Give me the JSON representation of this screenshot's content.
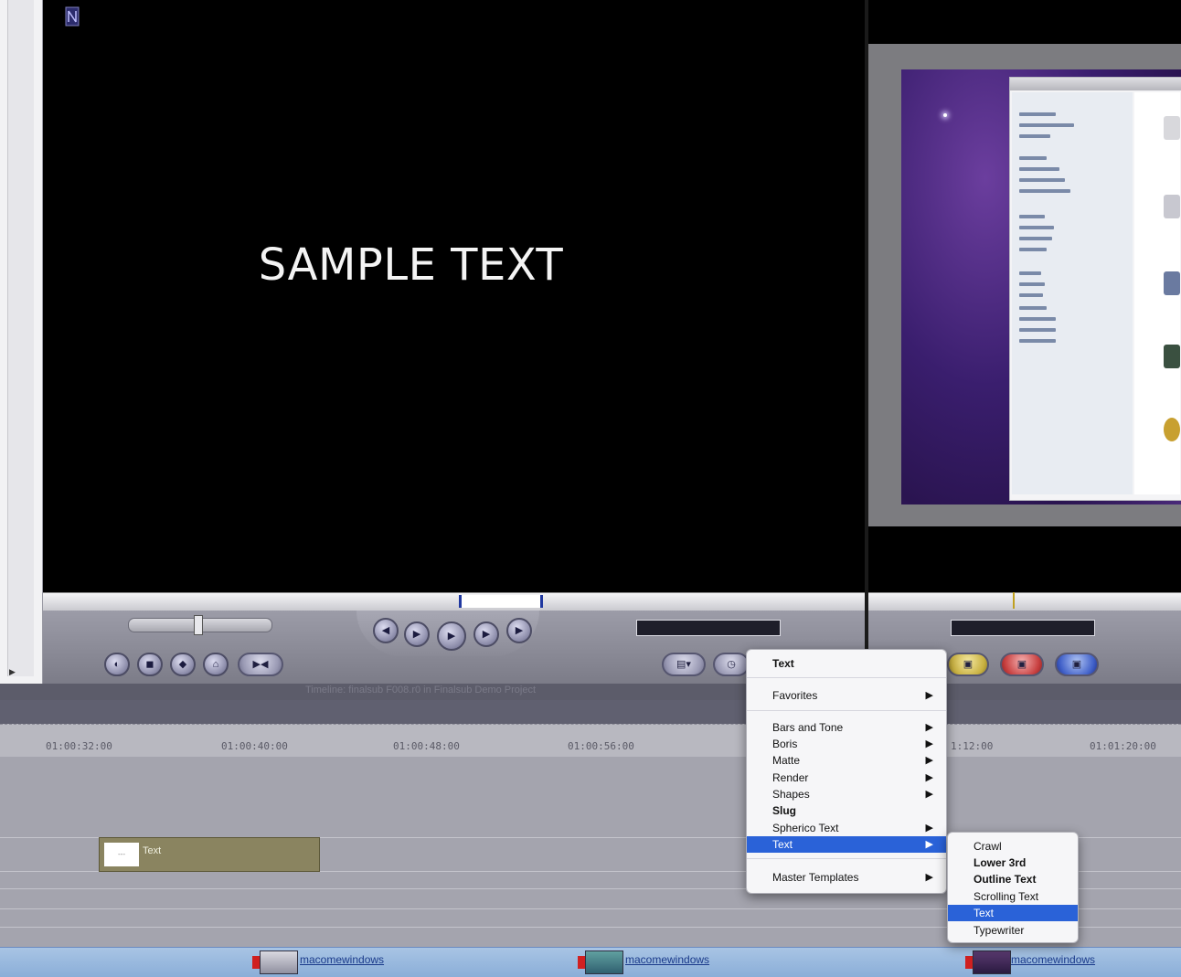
{
  "viewer": {
    "overlay_text": "SAMPLE TEXT"
  },
  "timeline": {
    "title": "Timeline: finalsub F008.r0 in Finalsub Demo Project",
    "timecodes": [
      "01:00:32:00",
      "01:00:40:00",
      "01:00:48:00",
      "01:00:56:00",
      "1:12:00",
      "01:01:20:00"
    ],
    "text_clip_label": "Text",
    "text_clip_thumb": "---",
    "video_clips": [
      "macomewindows",
      "macomewindows",
      "macomewindows"
    ]
  },
  "generator_menu": {
    "header": "Text",
    "favorites": "Favorites",
    "items": [
      "Bars and Tone",
      "Boris",
      "Matte",
      "Render",
      "Shapes",
      "Slug",
      "Spherico Text",
      "Text"
    ],
    "master_templates": "Master Templates",
    "highlighted": "Text"
  },
  "text_submenu": {
    "items": [
      "Crawl",
      "Lower 3rd",
      "Outline Text",
      "Scrolling Text",
      "Text",
      "Typewriter"
    ],
    "highlighted": "Text"
  },
  "colors": {
    "menu_highlight": "#2a62d8",
    "clip_olive": "#8a8460",
    "video_track": "#8aaed8"
  }
}
